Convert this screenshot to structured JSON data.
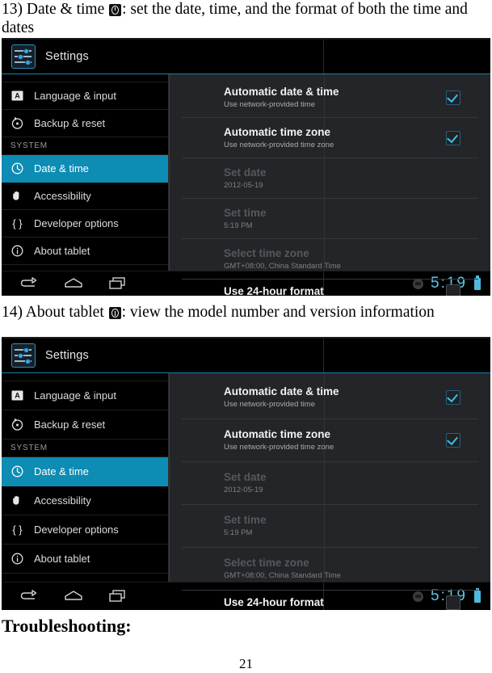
{
  "document": {
    "caption_13": {
      "prefix": "13) Date & time ",
      "icon": "clock-icon",
      "suffix": ": set the date, time, and the format of both the time and dates"
    },
    "caption_14": {
      "prefix": "14) About tablet ",
      "icon": "info-icon",
      "suffix": ": view the model number and version information"
    },
    "section_heading": "Troubleshooting:",
    "page_number": "21"
  },
  "screenshot": {
    "actionbar": {
      "app_icon": "settings-sliders-icon",
      "title": "Settings"
    },
    "sidebar": {
      "items": [
        {
          "label": "",
          "icon": "cut-off-icon",
          "selected": false,
          "cut": true
        },
        {
          "label": "Language & input",
          "icon": "keyboard-a-icon",
          "selected": false
        },
        {
          "label": "Backup & reset",
          "icon": "restore-icon",
          "selected": false
        }
      ],
      "section_header": "SYSTEM",
      "system_items": [
        {
          "label": "Date & time",
          "icon": "clock-icon",
          "selected": true
        },
        {
          "label": "Accessibility",
          "icon": "hand-icon",
          "selected": false
        },
        {
          "label": "Developer options",
          "icon": "braces-icon",
          "selected": false
        },
        {
          "label": "About tablet",
          "icon": "info-circle-icon",
          "selected": false
        }
      ]
    },
    "detail": {
      "rows": [
        {
          "title": "Automatic date & time",
          "subtitle": "Use network-provided time",
          "checked": true,
          "disabled": false
        },
        {
          "title": "Automatic time zone",
          "subtitle": "Use network-provided time zone",
          "checked": true,
          "disabled": false
        },
        {
          "title": "Set date",
          "subtitle": "2012-05-19",
          "checked": null,
          "disabled": true
        },
        {
          "title": "Set time",
          "subtitle": "5:19 PM",
          "checked": null,
          "disabled": true
        },
        {
          "title": "Select time zone",
          "subtitle": "GMT+08:00, China Standard Time",
          "checked": null,
          "disabled": true
        },
        {
          "title": "Use 24-hour format",
          "subtitle": "",
          "checked": false,
          "disabled": false
        }
      ]
    },
    "systembar": {
      "nav": [
        {
          "name": "back-icon"
        },
        {
          "name": "home-icon"
        },
        {
          "name": "recent-apps-icon"
        }
      ],
      "status_icon": "notification-dot-icon",
      "clock": "5:19",
      "battery_icon": "battery-full-icon"
    },
    "colors": {
      "accent": "#0d8cb4",
      "clock_cyan": "#5ec8e8",
      "check_cyan": "#35c4ee",
      "panel_bg": "#232528",
      "bar_bg": "#000000"
    }
  }
}
